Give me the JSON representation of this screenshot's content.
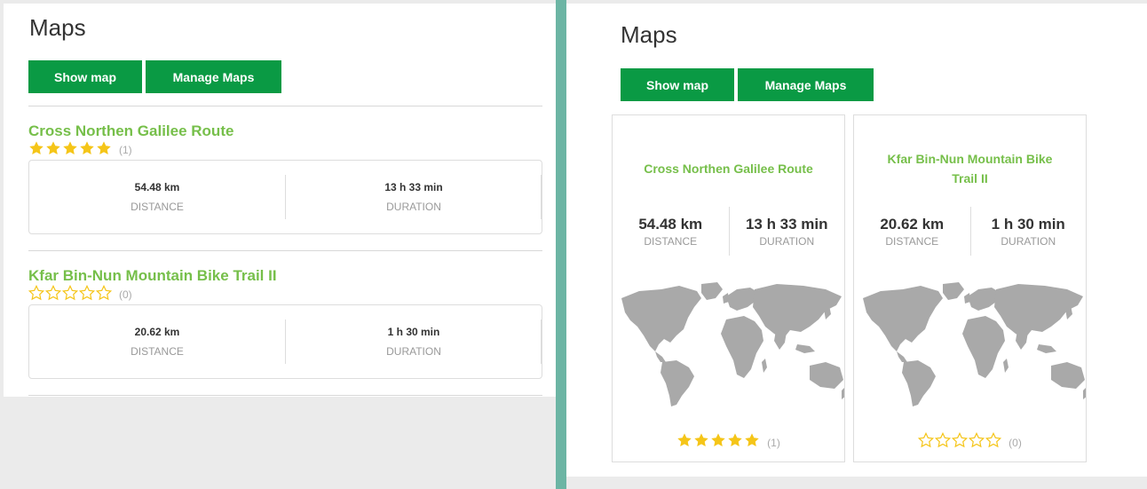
{
  "left": {
    "title": "Maps",
    "show_map_label": "Show map",
    "manage_maps_label": "Manage Maps",
    "routes": [
      {
        "name": "Cross Northen Galilee Route",
        "rating": 5,
        "rating_count": "(1)",
        "distance": "54.48 km",
        "distance_label": "DISTANCE",
        "duration": "13 h 33 min",
        "duration_label": "DURATION"
      },
      {
        "name": "Kfar Bin-Nun Mountain Bike Trail II",
        "rating": 0,
        "rating_count": "(0)",
        "distance": "20.62 km",
        "distance_label": "DISTANCE",
        "duration": "1 h 30 min",
        "duration_label": "DURATION"
      }
    ]
  },
  "right": {
    "title": "Maps",
    "show_map_label": "Show map",
    "manage_maps_label": "Manage Maps",
    "cards": [
      {
        "name": "Cross Northen Galilee Route",
        "rating": 5,
        "rating_count": "(1)",
        "distance": "54.48 km",
        "distance_label": "DISTANCE",
        "duration": "13 h 33 min",
        "duration_label": "DURATION"
      },
      {
        "name": "Kfar Bin-Nun Mountain Bike Trail II",
        "rating": 0,
        "rating_count": "(0)",
        "distance": "20.62 km",
        "distance_label": "DISTANCE",
        "duration": "1 h 30 min",
        "duration_label": "DURATION"
      }
    ]
  },
  "colors": {
    "button_bg": "#0a9a44",
    "route_name": "#76bf4a",
    "star": "#f5c518",
    "splitter": "#6cb5a4",
    "map": "#a9a9a9"
  },
  "icons": {
    "star_filled": "star-filled-icon",
    "star_empty": "star-outline-icon",
    "map": "world-map-icon"
  }
}
